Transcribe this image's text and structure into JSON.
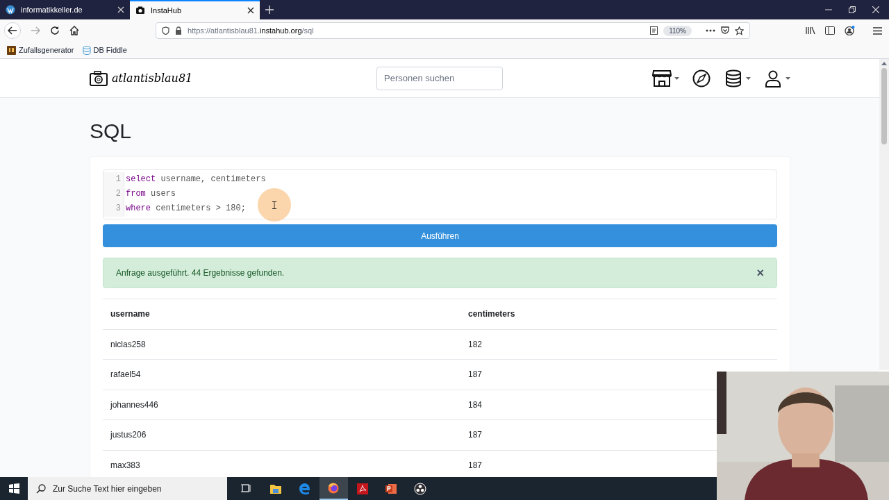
{
  "browser": {
    "tabs": [
      {
        "title": "informatikkeller.de",
        "selected": false,
        "kind": "wordpress"
      },
      {
        "title": "InstaHub",
        "selected": true,
        "kind": "camera"
      }
    ],
    "url": {
      "prefix": "https://atlantisblau81.",
      "host": "instahub.org",
      "path": "/sql"
    },
    "zoom": "110%",
    "bookmarks": [
      {
        "label": "Zufallsgenerator",
        "kind": "us"
      },
      {
        "label": "DB Fiddle",
        "kind": "database"
      }
    ]
  },
  "navbar": {
    "brand": "atlantisblau81",
    "search": {
      "placeholder": "Personen suchen"
    }
  },
  "page": {
    "heading": "SQL",
    "code": [
      {
        "number": "1",
        "tokens": [
          {
            "kind": "keyword",
            "text": "select"
          },
          {
            "kind": "plain",
            "text": " username, centimeters"
          }
        ]
      },
      {
        "number": "2",
        "tokens": [
          {
            "kind": "keyword",
            "text": "from"
          },
          {
            "kind": "plain",
            "text": " users"
          }
        ]
      },
      {
        "number": "3",
        "tokens": [
          {
            "kind": "keyword",
            "text": "where"
          },
          {
            "kind": "plain",
            "text": " centimeters > 180;"
          }
        ]
      }
    ],
    "run_button": "Ausführen",
    "alert": {
      "message": "Anfrage ausgeführt. 44 Ergebnisse gefunden.",
      "close": "×"
    },
    "table": {
      "columns": [
        "username",
        "centimeters"
      ],
      "rows": [
        [
          "niclas258",
          "182"
        ],
        [
          "rafael54",
          "187"
        ],
        [
          "johannes446",
          "184"
        ],
        [
          "justus206",
          "187"
        ],
        [
          "max383",
          "187"
        ]
      ]
    }
  },
  "taskbar": {
    "search": {
      "placeholder": "Zur Suche Text hier eingeben"
    },
    "apps": [
      {
        "kind": "taskview",
        "selected": false
      },
      {
        "kind": "explorer",
        "selected": false
      },
      {
        "kind": "edge",
        "selected": false
      },
      {
        "kind": "firefox",
        "selected": true
      },
      {
        "kind": "acrobat",
        "selected": false
      },
      {
        "kind": "powerpoint",
        "selected": false
      },
      {
        "kind": "obs",
        "selected": false
      }
    ]
  }
}
